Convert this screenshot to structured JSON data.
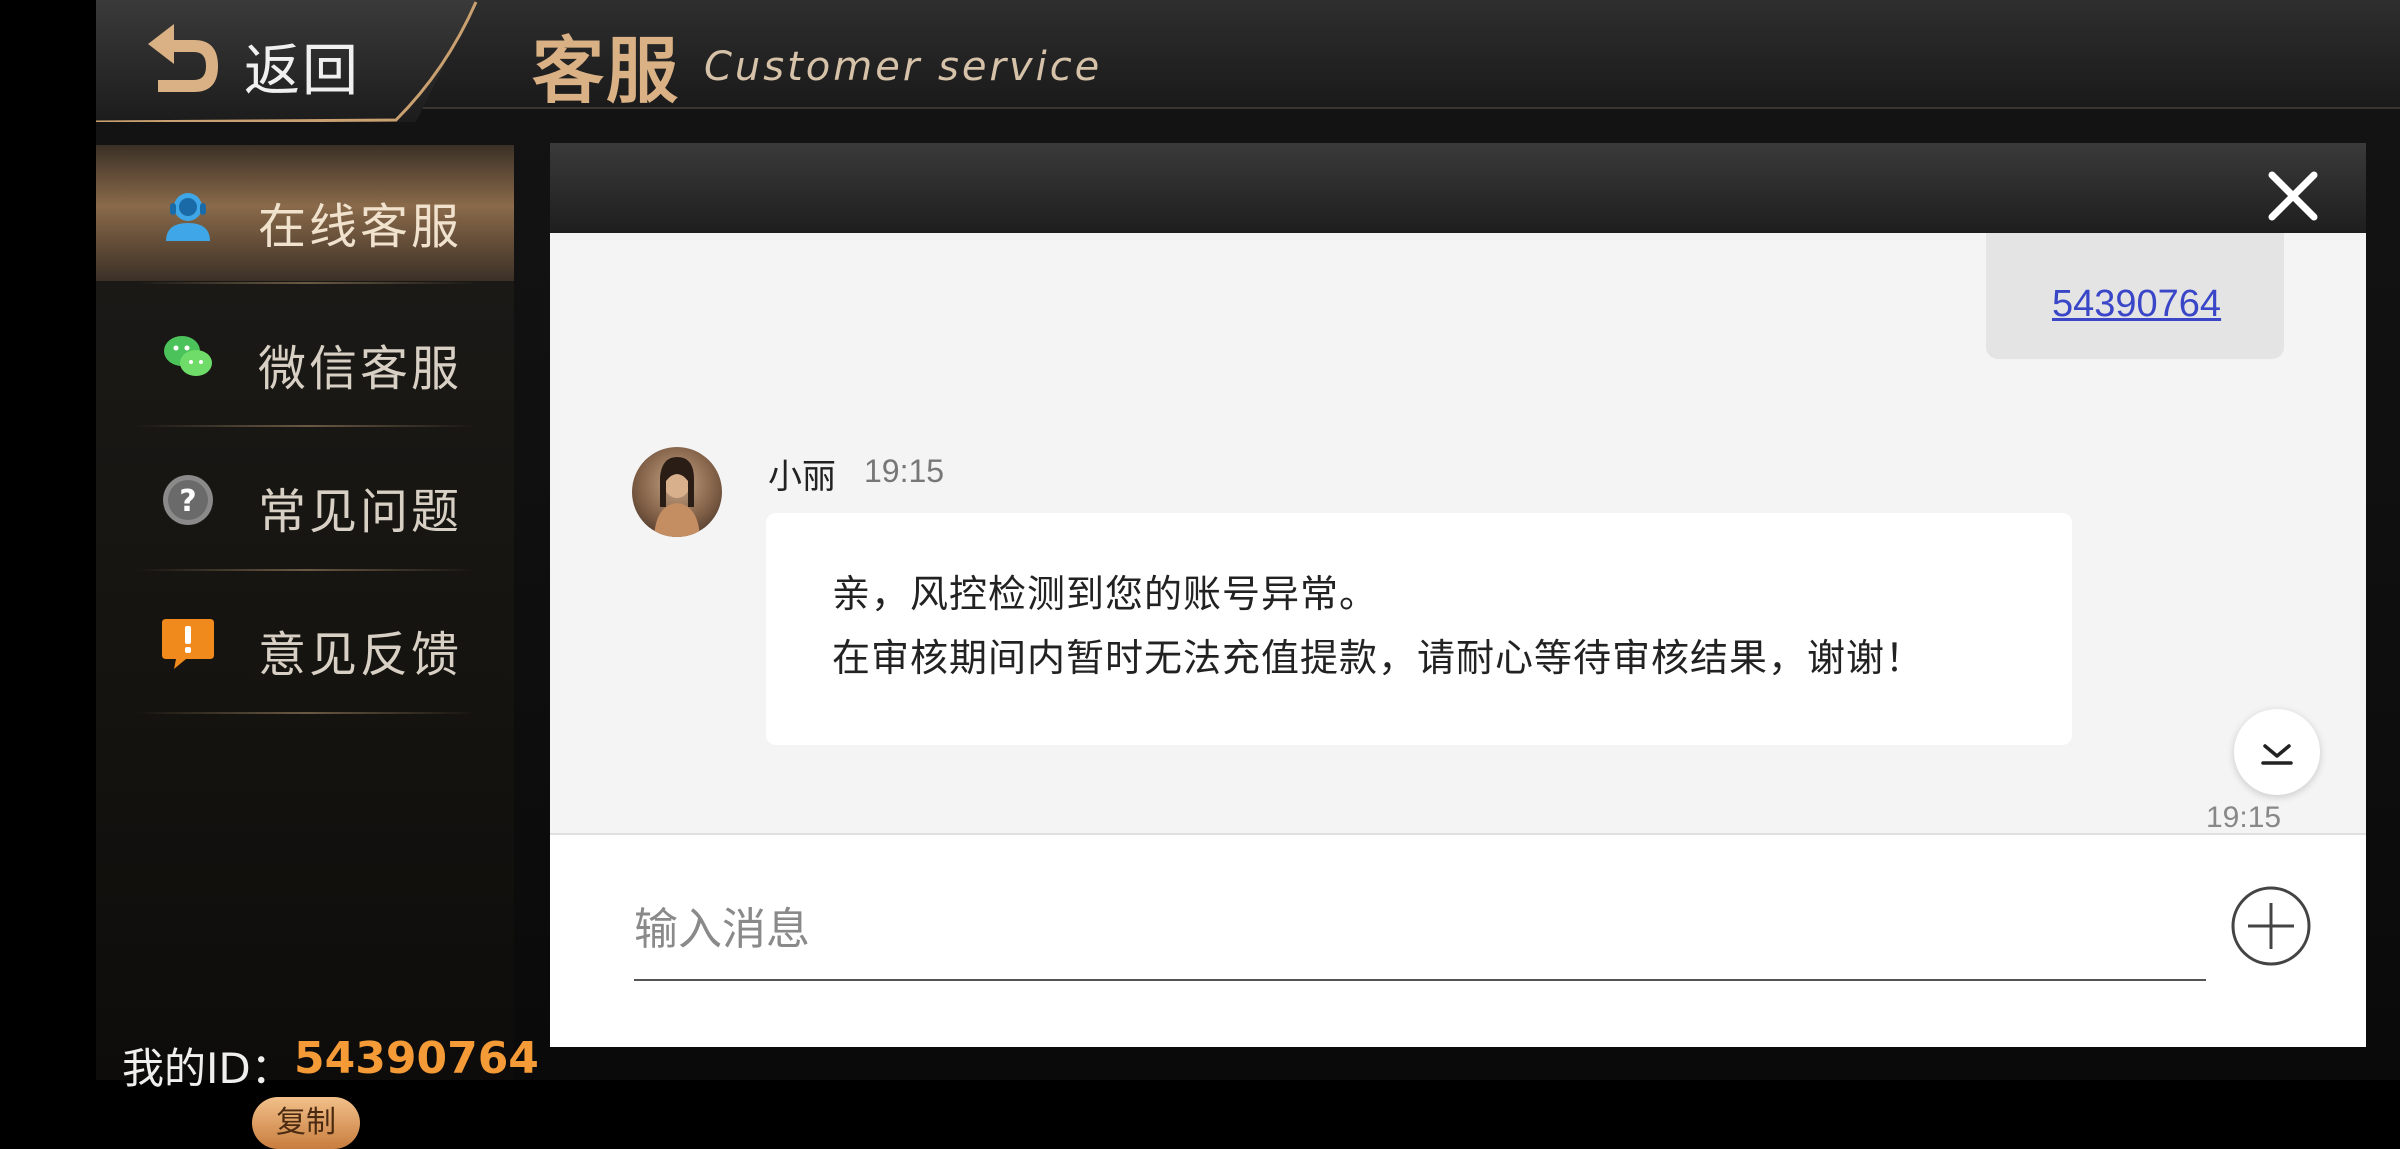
{
  "header": {
    "back_label": "返回",
    "title_cn": "客服",
    "title_en": "Customer service"
  },
  "sidebar": {
    "items": [
      {
        "label": "在线客服",
        "icon": "agent-icon",
        "active": true
      },
      {
        "label": "微信客服",
        "icon": "wechat-icon",
        "active": false
      },
      {
        "label": "常见问题",
        "icon": "question-icon",
        "active": false
      },
      {
        "label": "意见反馈",
        "icon": "feedback-icon",
        "active": false
      }
    ],
    "id_label": "我的ID：",
    "id_value": "54390764",
    "copy_label": "复制"
  },
  "chat": {
    "sent_message": "54390764",
    "messages": [
      {
        "sender": "小丽",
        "time": "19:15",
        "lines": [
          "亲，风控检测到您的账号异常。",
          "在审核期间内暂时无法充值提款，请耐心等待审核结果，谢谢！"
        ]
      }
    ],
    "bottom_time": "19:15",
    "input_placeholder": "输入消息"
  },
  "colors": {
    "accent_gold": "#d9b184",
    "id_orange": "#f49a36",
    "link_blue": "#3a46c8"
  }
}
